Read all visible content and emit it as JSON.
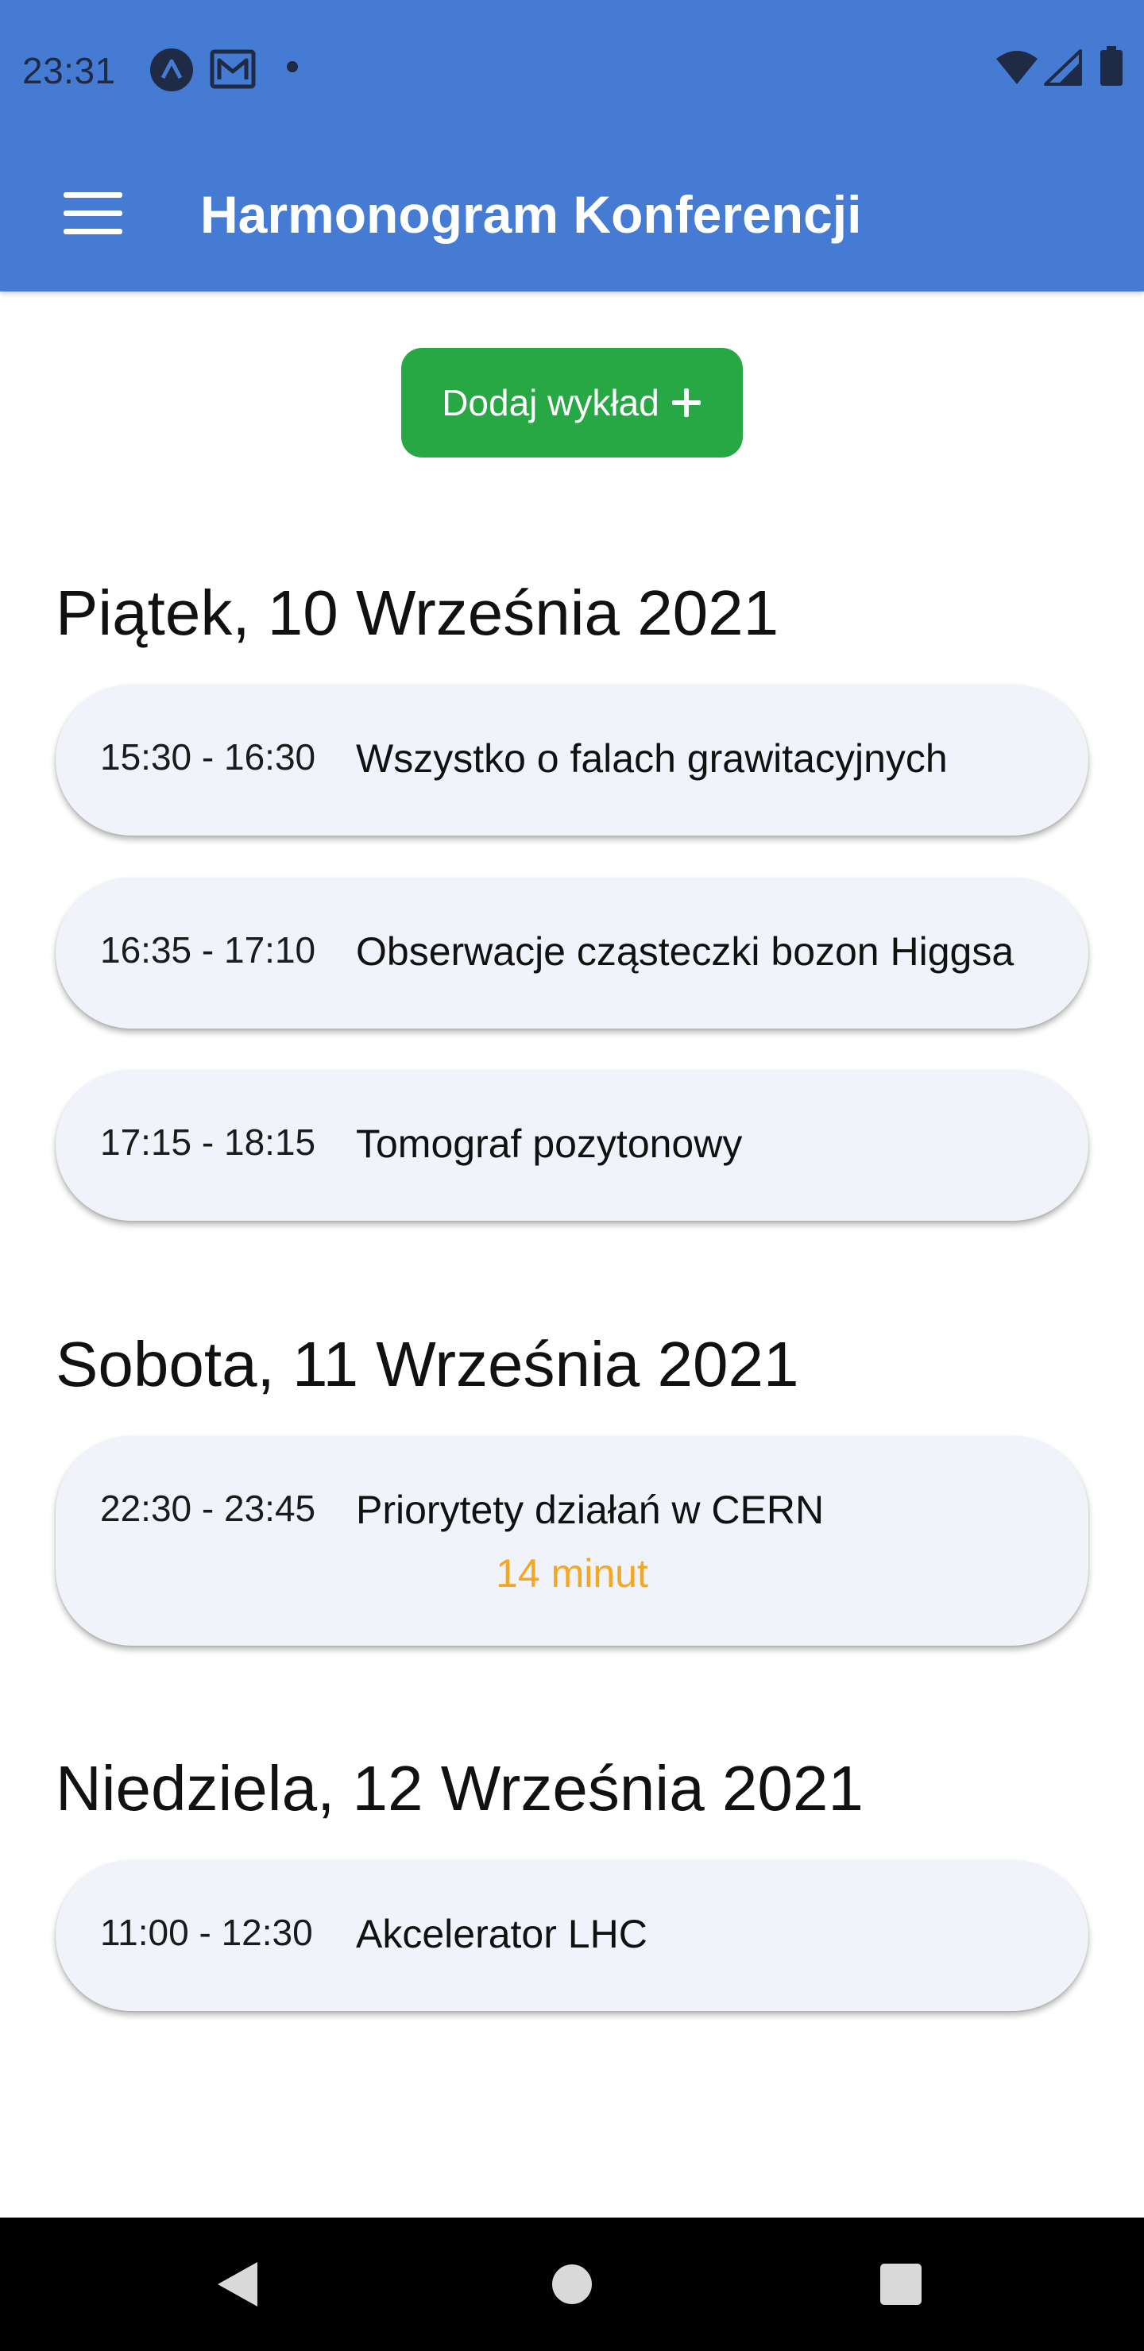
{
  "status_bar": {
    "time": "23:31",
    "left_icons": [
      "app-notification-icon",
      "mail-icon",
      "dot-icon"
    ],
    "right_icons": [
      "wifi-icon",
      "signal-icon",
      "battery-icon"
    ]
  },
  "app_bar": {
    "title": "Harmonogram Konferencji",
    "menu_icon": "hamburger-menu-icon",
    "background_color": "#467BD4"
  },
  "add_button": {
    "label": "Dodaj wykład",
    "icon": "plus-icon",
    "color": "#28A745"
  },
  "days": [
    {
      "heading": "Piątek, 10 Września 2021",
      "talks": [
        {
          "time": "15:30 - 16:30",
          "title": "Wszystko o falach grawitacyjnych"
        },
        {
          "time": "16:35 - 17:10",
          "title": "Obserwacje cząsteczki bozon Higgsa"
        },
        {
          "time": "17:15 - 18:15",
          "title": "Tomograf pozytonowy"
        }
      ]
    },
    {
      "heading": "Sobota, 11 Września 2021",
      "talks": [
        {
          "time": "22:30 - 23:45",
          "title": "Priorytety działań w CERN",
          "countdown": "14 minut"
        }
      ]
    },
    {
      "heading": "Niedziela, 12 Września 2021",
      "talks": [
        {
          "time": "11:00 - 12:30",
          "title": "Akcelerator LHC"
        }
      ]
    }
  ],
  "colors": {
    "card_background": "#F1F3FA",
    "countdown": "#F5A623"
  },
  "nav_bar": {
    "icons": [
      "back-triangle-icon",
      "home-circle-icon",
      "recents-square-icon"
    ]
  }
}
